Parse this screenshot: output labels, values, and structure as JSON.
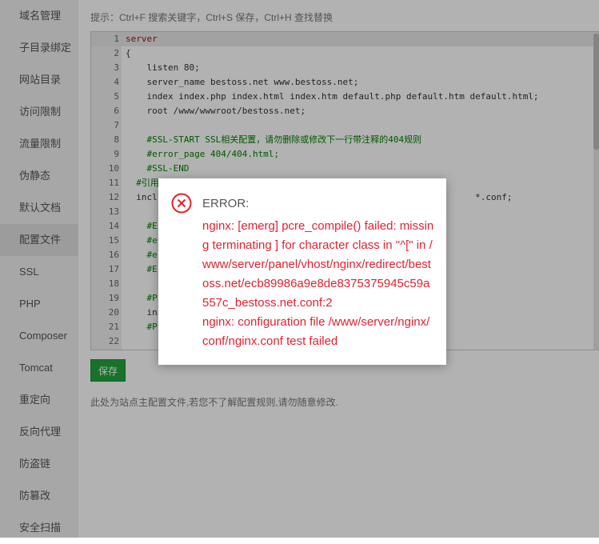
{
  "sidebar": {
    "items": [
      {
        "label": "域名管理",
        "active": false
      },
      {
        "label": "子目录绑定",
        "active": false
      },
      {
        "label": "网站目录",
        "active": false
      },
      {
        "label": "访问限制",
        "active": false
      },
      {
        "label": "流量限制",
        "active": false
      },
      {
        "label": "伪静态",
        "active": false
      },
      {
        "label": "默认文档",
        "active": false
      },
      {
        "label": "配置文件",
        "active": true
      },
      {
        "label": "SSL",
        "active": false
      },
      {
        "label": "PHP",
        "active": false
      },
      {
        "label": "Composer",
        "active": false
      },
      {
        "label": "Tomcat",
        "active": false
      },
      {
        "label": "重定向",
        "active": false
      },
      {
        "label": "反向代理",
        "active": false
      },
      {
        "label": "防盗链",
        "active": false
      },
      {
        "label": "防篡改",
        "active": false
      },
      {
        "label": "安全扫描",
        "active": false
      }
    ]
  },
  "main": {
    "tip": "提示：Ctrl+F 搜索关键字，Ctrl+S 保存，Ctrl+H 查找替换",
    "editor_lines": [
      {
        "n": "1",
        "text": "server",
        "style": "kw-red",
        "active": true
      },
      {
        "n": "2",
        "text": "{",
        "style": "",
        "active": false
      },
      {
        "n": "3",
        "text": "    listen 80;",
        "style": "",
        "active": false
      },
      {
        "n": "4",
        "text": "    server_name bestoss.net www.bestoss.net;",
        "style": "",
        "active": false
      },
      {
        "n": "5",
        "text": "    index index.php index.html index.htm default.php default.htm default.html;",
        "style": "",
        "active": false
      },
      {
        "n": "6",
        "text": "    root /www/wwwroot/bestoss.net;",
        "style": "",
        "active": false
      },
      {
        "n": "7",
        "text": "",
        "style": "",
        "active": false
      },
      {
        "n": "8",
        "text": "    #SSL-START SSL相关配置，请勿删除或修改下一行带注释的404规则",
        "style": "comment",
        "active": false
      },
      {
        "n": "9",
        "text": "    #error_page 404/404.html;",
        "style": "comment",
        "active": false
      },
      {
        "n": "10",
        "text": "    #SSL-END",
        "style": "comment",
        "active": false
      },
      {
        "n": "11",
        "text": "  #引用",
        "style": "comment",
        "active": false
      },
      {
        "n": "12",
        "text": "  incl                                                            *.conf;",
        "style": "",
        "active": false
      },
      {
        "n": "13",
        "text": "",
        "style": "",
        "active": false
      },
      {
        "n": "14",
        "text": "    #E",
        "style": "comment",
        "active": false
      },
      {
        "n": "15",
        "text": "    #e",
        "style": "comment",
        "active": false
      },
      {
        "n": "16",
        "text": "    #e",
        "style": "comment",
        "active": false
      },
      {
        "n": "17",
        "text": "    #E",
        "style": "comment",
        "active": false
      },
      {
        "n": "18",
        "text": "",
        "style": "",
        "active": false
      },
      {
        "n": "19",
        "text": "    #P",
        "style": "comment",
        "active": false
      },
      {
        "n": "20",
        "text": "    in",
        "style": "",
        "active": false
      },
      {
        "n": "21",
        "text": "    #P",
        "style": "comment",
        "active": false
      },
      {
        "n": "22",
        "text": "",
        "style": "",
        "active": false
      }
    ],
    "save_label": "保存",
    "note": "此处为站点主配置文件,若您不了解配置规则,请勿随意修改."
  },
  "dialog": {
    "icon": "error-circle-x-icon",
    "title": "ERROR:",
    "lines": [
      "nginx: [emerg] pcre_compile() failed: missing terminating ] for character class in \"^[\" in /www/server/panel/vhost/nginx/redirect/bestoss.net/ecb89986a9e8de8375375945c59a557c_bestoss.net.conf:2",
      "nginx: configuration file /www/server/nginx/conf/nginx.conf test failed"
    ]
  },
  "colors": {
    "accent": "#20a53a",
    "error": "#e8202c"
  }
}
